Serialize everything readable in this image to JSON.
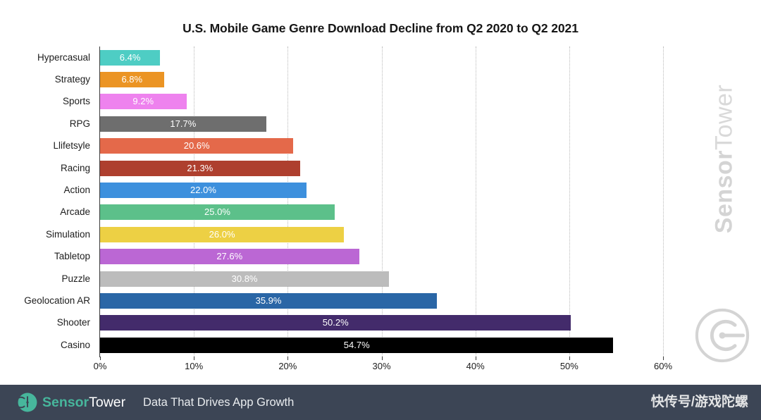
{
  "chart_data": {
    "type": "bar",
    "orientation": "horizontal",
    "title": "U.S. Mobile Game Genre Download Decline from Q2 2020 to Q2 2021",
    "xlabel": "",
    "ylabel": "",
    "xlim": [
      0,
      60
    ],
    "grid": "vertical-dotted",
    "legend": "none",
    "value_suffix": "%",
    "categories": [
      "Hypercasual",
      "Strategy",
      "Sports",
      "RPG",
      "Llifetsyle",
      "Racing",
      "Action",
      "Arcade",
      "Simulation",
      "Tabletop",
      "Puzzle",
      "Geolocation AR",
      "Shooter",
      "Casino"
    ],
    "values": [
      6.4,
      6.8,
      9.2,
      17.7,
      20.6,
      21.3,
      22.0,
      25.0,
      26.0,
      27.6,
      30.8,
      35.9,
      50.2,
      54.7
    ],
    "value_labels": [
      "6.4%",
      "6.8%",
      "9.2%",
      "17.7%",
      "20.6%",
      "21.3%",
      "22.0%",
      "25.0%",
      "26.0%",
      "27.6%",
      "30.8%",
      "35.9%",
      "50.2%",
      "54.7%"
    ],
    "colors": [
      "#4ecdc4",
      "#eb9424",
      "#ee82ee",
      "#6e6e6e",
      "#e4694a",
      "#ae3f2e",
      "#3d90dd",
      "#5cc08a",
      "#edd044",
      "#bb67d4",
      "#bcbcbc",
      "#2a66a6",
      "#432b6b",
      "#000000"
    ],
    "xticks": [
      0,
      10,
      20,
      30,
      40,
      50,
      60
    ],
    "xtick_labels": [
      "0%",
      "10%",
      "20%",
      "30%",
      "40%",
      "50%",
      "60%"
    ]
  },
  "watermark": {
    "brand_bold": "Sensor",
    "brand_light": "Tower",
    "logo_icon": "sensortower-logo-icon"
  },
  "footer": {
    "logo_icon": "sensortower-logo-icon",
    "brand_bold": "Sensor",
    "brand_light": "Tower",
    "tagline": "Data That Drives App Growth",
    "source_watermark": "快传号/游戏陀螺"
  }
}
